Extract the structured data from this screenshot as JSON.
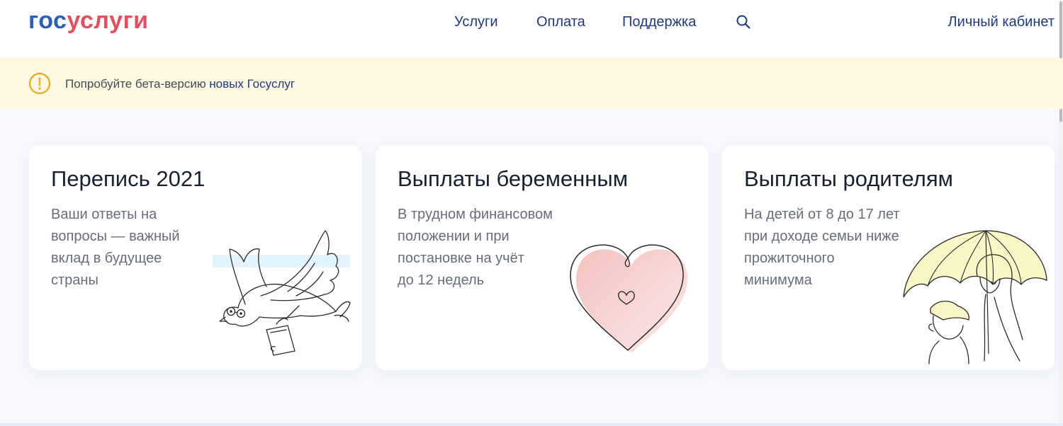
{
  "header": {
    "logo_part1": "гос",
    "logo_part2": "услуги",
    "nav": {
      "services": "Услуги",
      "payment": "Оплата",
      "support": "Поддержка"
    },
    "cabinet": "Личный кабинет"
  },
  "banner": {
    "text": "Попробуйте бета-версию ",
    "link": "новых Госуслуг"
  },
  "cards": [
    {
      "title": "Перепись 2021",
      "lines": [
        "Ваши ответы на",
        "вопросы — важный",
        "вклад в будущее",
        "страны"
      ]
    },
    {
      "title": "Выплаты беременным",
      "lines": [
        "В трудном финансовом",
        "положении и при",
        "постановке на учёт",
        "до 12 недель"
      ]
    },
    {
      "title": "Выплаты родителям",
      "lines": [
        "На детей от 8 до 17 лет",
        "при доходе семьи ниже",
        "прожиточного",
        "минимума"
      ]
    }
  ],
  "colors": {
    "logo_blue": "#2d5fb5",
    "logo_red": "#e2505f",
    "nav_text": "#1f3a7a",
    "banner_bg": "#fff8e0",
    "banner_icon": "#e1b23a",
    "page_bg": "#f6f8fc"
  }
}
